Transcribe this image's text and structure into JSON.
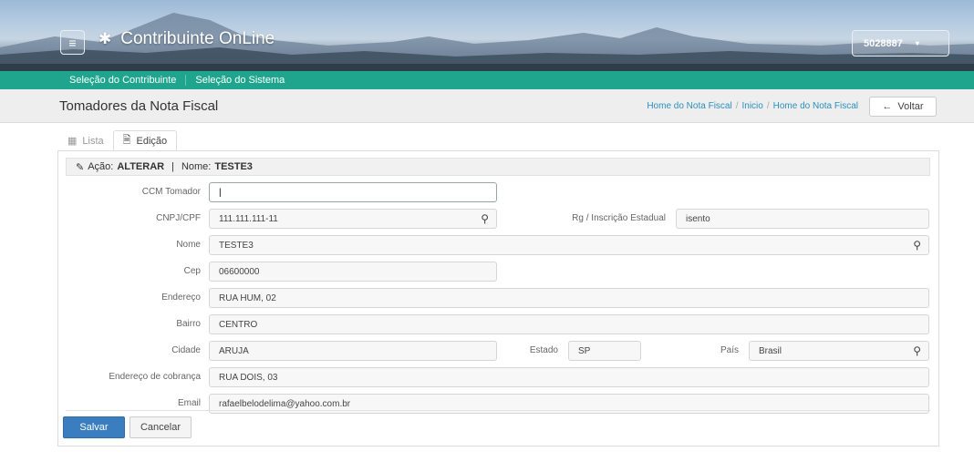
{
  "header": {
    "menu_icon": "hamburger-icon",
    "brand_icon": "gear-icon",
    "brand_title": "Contribuinte OnLine",
    "user_label": "5028887",
    "user_caret": "▾"
  },
  "nav": {
    "items": [
      {
        "label": "Seleção do Contribuinte"
      },
      {
        "label": "Seleção do Sistema"
      }
    ]
  },
  "titlebar": {
    "page_title": "Tomadores da Nota Fiscal",
    "breadcrumb": [
      "Home do Nota Fiscal",
      "Inicio",
      "Home do Nota Fiscal"
    ],
    "breadcrumb_sep": "/",
    "back_label": "Voltar",
    "back_icon": "arrow-left-icon"
  },
  "tabs": [
    {
      "label": "Lista",
      "icon": "table-icon",
      "active": false
    },
    {
      "label": "Edição",
      "icon": "document-icon",
      "active": true
    }
  ],
  "action": {
    "icon": "pencil-icon",
    "prefix": "Ação:",
    "value": "ALTERAR",
    "separator": "|",
    "name_label": "Nome:",
    "name_value": "TESTE3"
  },
  "form": {
    "ccm_label": "CCM Tomador",
    "ccm_value": "",
    "cnpj_label": "CNPJ/CPF",
    "cnpj_value": "111.111.111-11",
    "rg_label": "Rg / Inscrição Estadual",
    "rg_value": "isento",
    "nome_label": "Nome",
    "nome_value": "TESTE3",
    "cep_label": "Cep",
    "cep_value": "06600000",
    "endereco_label": "Endereço",
    "endereco_value": "RUA HUM, 02",
    "bairro_label": "Bairro",
    "bairro_value": "CENTRO",
    "cidade_label": "Cidade",
    "cidade_value": "ARUJA",
    "estado_label": "Estado",
    "estado_value": "SP",
    "pais_label": "País",
    "pais_value": "Brasil",
    "cobranca_label": "Endereço de cobrança",
    "cobranca_value": "RUA DOIS, 03",
    "email_label": "Email",
    "email_value": "rafaelbelodelima@yahoo.com.br",
    "search_icon": "search-icon"
  },
  "buttons": {
    "save_label": "Salvar",
    "cancel_label": "Cancelar"
  },
  "colors": {
    "nav_bg": "#1fa58e",
    "primary_btn": "#3a7ebf",
    "link": "#2a8fbd"
  }
}
